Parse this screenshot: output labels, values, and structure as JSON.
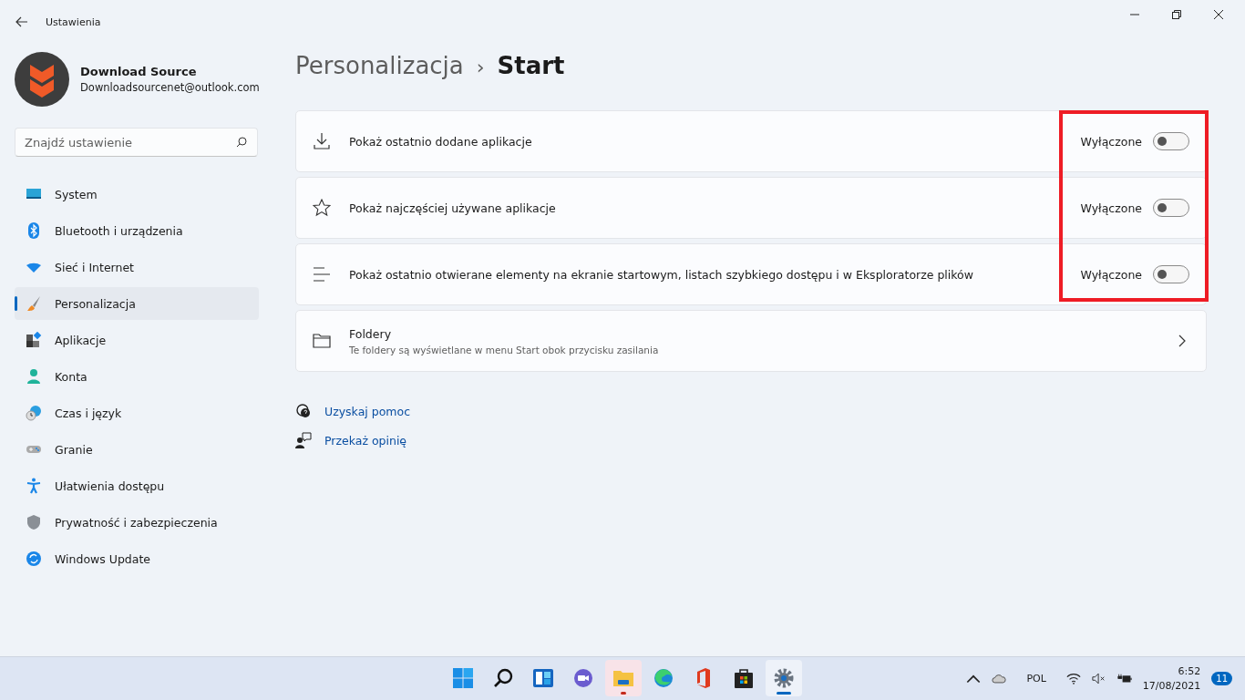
{
  "window": {
    "title": "Ustawienia"
  },
  "profile": {
    "name": "Download Source",
    "email": "Downloadsourcenet@outlook.com"
  },
  "search": {
    "placeholder": "Znajdź ustawienie"
  },
  "sidebar": {
    "items": [
      {
        "label": "System",
        "kind": "system",
        "selected": false
      },
      {
        "label": "Bluetooth i urządzenia",
        "kind": "bluetooth",
        "selected": false
      },
      {
        "label": "Sieć i Internet",
        "kind": "network",
        "selected": false
      },
      {
        "label": "Personalizacja",
        "kind": "brush",
        "selected": true
      },
      {
        "label": "Aplikacje",
        "kind": "apps",
        "selected": false
      },
      {
        "label": "Konta",
        "kind": "person",
        "selected": false
      },
      {
        "label": "Czas i język",
        "kind": "clock",
        "selected": false
      },
      {
        "label": "Granie",
        "kind": "gamepad",
        "selected": false
      },
      {
        "label": "Ułatwienia dostępu",
        "kind": "accessibility",
        "selected": false
      },
      {
        "label": "Prywatność i zabezpieczenia",
        "kind": "shield",
        "selected": false
      },
      {
        "label": "Windows Update",
        "kind": "update",
        "selected": false
      }
    ]
  },
  "breadcrumb": {
    "parent": "Personalizacja",
    "separator": "›",
    "current": "Start"
  },
  "settings": [
    {
      "kind": "toggle",
      "label": "Pokaż ostatnio dodane aplikacje",
      "state_label": "Wyłączone",
      "on": false
    },
    {
      "kind": "toggle",
      "label": "Pokaż najczęściej używane aplikacje",
      "state_label": "Wyłączone",
      "on": false
    },
    {
      "kind": "toggle",
      "label": "Pokaż ostatnio otwierane elementy na ekranie startowym, listach szybkiego dostępu i w Eksploratorze plików",
      "state_label": "Wyłączone",
      "on": false
    },
    {
      "kind": "link",
      "label": "Foldery",
      "description": "Te foldery są wyświetlane w menu Start obok przycisku zasilania"
    }
  ],
  "highlight_frame": true,
  "help_links": [
    {
      "kind": "help",
      "label": "Uzyskaj pomoc"
    },
    {
      "kind": "feedback",
      "label": "Przekaż opinię"
    }
  ],
  "taskbar": {
    "apps": [
      {
        "kind": "start",
        "active": false,
        "running": false
      },
      {
        "kind": "search",
        "active": false,
        "running": false
      },
      {
        "kind": "widgets",
        "active": false,
        "running": false
      },
      {
        "kind": "chat",
        "active": false,
        "running": false
      },
      {
        "kind": "explorer",
        "active": false,
        "running": true
      },
      {
        "kind": "edge",
        "active": false,
        "running": false
      },
      {
        "kind": "office",
        "active": false,
        "running": false
      },
      {
        "kind": "store",
        "active": false,
        "running": false
      },
      {
        "kind": "settings",
        "active": true,
        "running": true
      }
    ],
    "language": "POL",
    "time": "6:52",
    "date": "17/08/2021",
    "notifications": "11"
  }
}
